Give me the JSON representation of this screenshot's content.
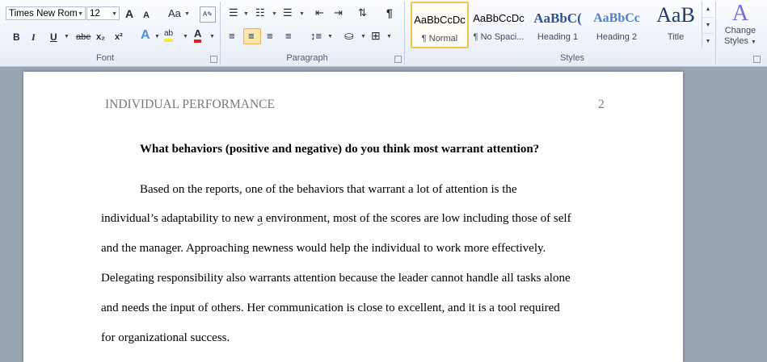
{
  "ribbon": {
    "font_group": {
      "label": "Font",
      "font_name": "Times New Rom",
      "font_size": "12",
      "grow_font": "A",
      "shrink_font": "A",
      "change_case": "Aa",
      "bold": "B",
      "italic": "I",
      "underline": "U",
      "strikethrough": "abe",
      "subscript": "x₂",
      "superscript": "x²",
      "text_effects": "A",
      "highlight": "ab",
      "font_color": "A"
    },
    "paragraph_group": {
      "label": "Paragraph"
    },
    "styles_group": {
      "label": "Styles",
      "styles": [
        {
          "sample": "AaBbCcDc",
          "name": "¶ Normal"
        },
        {
          "sample": "AaBbCcDc",
          "name": "¶ No Spaci..."
        },
        {
          "sample": "AaBbC(",
          "name": "Heading 1"
        },
        {
          "sample": "AaBbCc",
          "name": "Heading 2"
        },
        {
          "sample": "AaB",
          "name": "Title"
        }
      ]
    },
    "change_styles": {
      "icon_letter": "A",
      "line1": "Change",
      "line2": "Styles"
    }
  },
  "document": {
    "header_left": "INDIVIDUAL PERFORMANCE",
    "page_number": "2",
    "question": "What behaviors (positive and negative) do you think most warrant attention?",
    "body": {
      "line1": "Based on the reports, one of the behaviors that warrant a lot of attention is the",
      "line2_before": "individual’s adaptability to new ",
      "line2_flagged": "a",
      "line2_after": " environment, most of the scores are low including those of self",
      "line3": "and the manager. Approaching newness would help the individual to work more effectively.",
      "line4": "Delegating responsibility also warrants attention because the leader cannot handle all tasks alone",
      "line5": "and needs the input of others. Her communication is close to excellent, and it is a tool required",
      "line6": "for organizational success."
    }
  },
  "colors": {
    "highlight": "#f5ee2a",
    "font_color": "#d82020",
    "active_style_border": "#f2c24d"
  }
}
